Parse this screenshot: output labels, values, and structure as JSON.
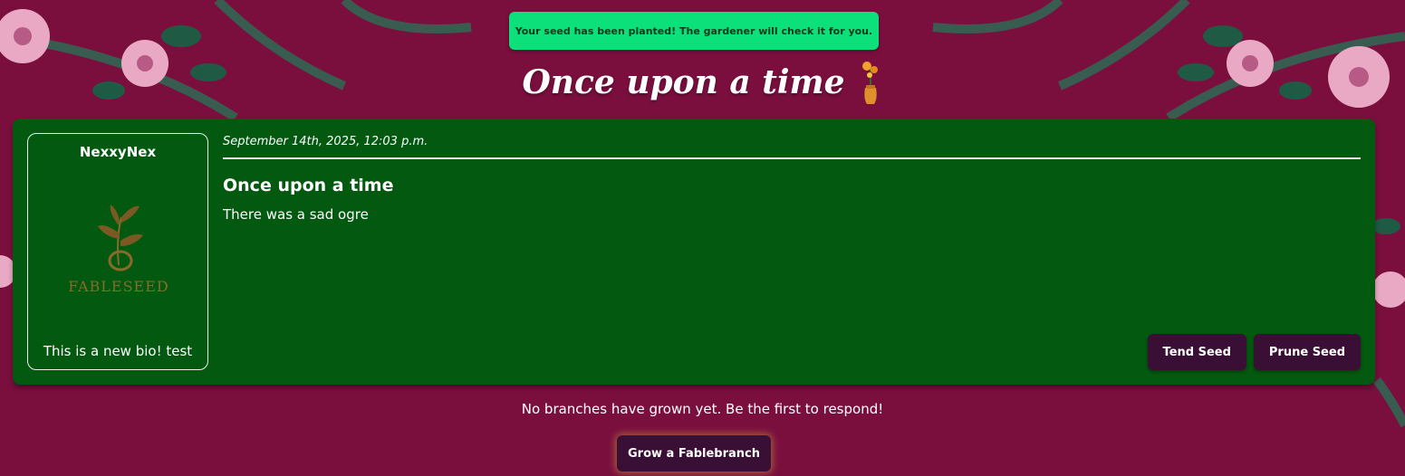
{
  "flash": {
    "message": "Your seed has been planted! The gardener will check it for you."
  },
  "page": {
    "title": "Once upon a time"
  },
  "post": {
    "author": {
      "username": "NexxyNex",
      "avatar_logo_text": "FABLESEED",
      "bio": "This is a new bio! test"
    },
    "date": "September 14th, 2025, 12:03 p.m.",
    "title": "Once upon a time",
    "body": "There was a sad ogre",
    "actions": {
      "tend_label": "Tend Seed",
      "prune_label": "Prune Seed"
    }
  },
  "branches": {
    "empty_message": "No branches have grown yet. Be the first to respond!",
    "grow_label": "Grow a Fablebranch"
  },
  "colors": {
    "background": "#7a0f3e",
    "card": "#02590f",
    "flash": "#0be07a",
    "button": "#3a0f35"
  },
  "icons": [
    "vase-flower-icon",
    "sprout-logo-icon"
  ]
}
